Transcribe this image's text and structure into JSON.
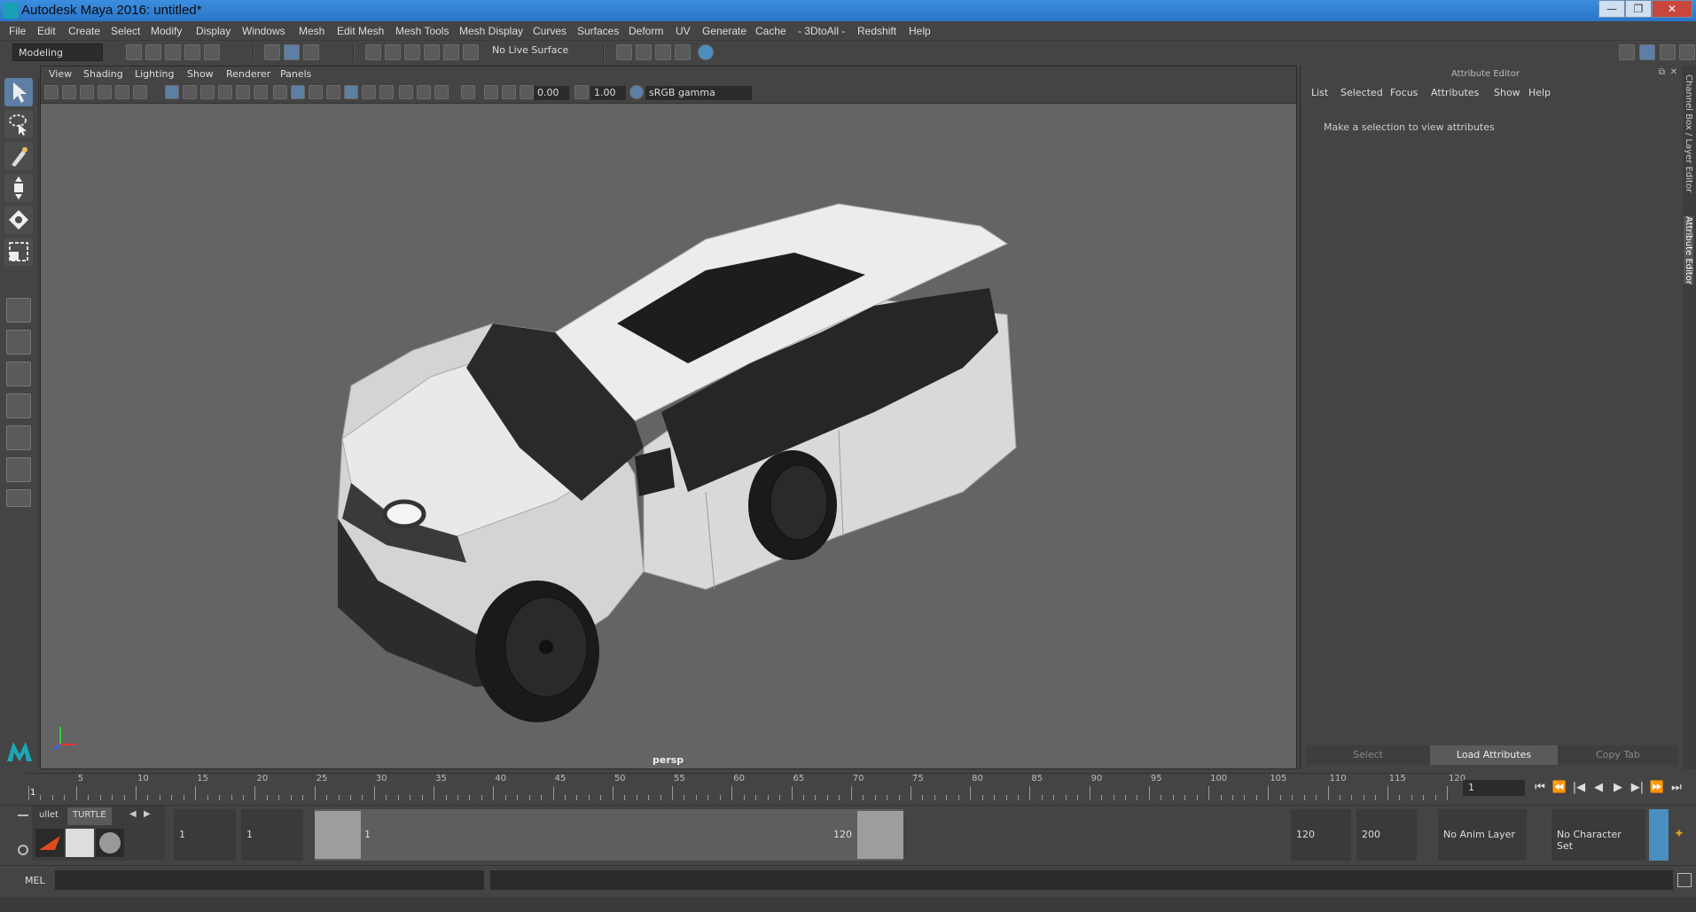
{
  "window": {
    "title": "Autodesk Maya 2016: untitled*",
    "buttons": [
      "—",
      "❐",
      "✕"
    ]
  },
  "menubar": [
    "File",
    "Edit",
    "Create",
    "Select",
    "Modify",
    "Display",
    "Windows",
    "Mesh",
    "Edit Mesh",
    "Mesh Tools",
    "Mesh Display",
    "Curves",
    "Surfaces",
    "Deform",
    "UV",
    "Generate",
    "Cache",
    "- 3DtoAll -",
    "Redshift",
    "Help"
  ],
  "statusline": {
    "mode": "Modeling",
    "live_surface": "No Live Surface"
  },
  "viewport": {
    "menu": [
      "View",
      "Shading",
      "Lighting",
      "Show",
      "Renderer",
      "Panels"
    ],
    "exposure": "0.00",
    "gamma": "1.00",
    "color_space": "sRGB gamma",
    "camera_label": "persp"
  },
  "attribute_editor": {
    "title": "Attribute Editor",
    "menu": [
      "List",
      "Selected",
      "Focus",
      "Attributes",
      "Show",
      "Help"
    ],
    "message": "Make a selection to view attributes",
    "buttons": [
      "Select",
      "Load Attributes",
      "Copy Tab"
    ],
    "side_tabs": [
      "Channel Box / Layer Editor",
      "Attribute Editor"
    ]
  },
  "timeline": {
    "tick_labels": [
      "1",
      "5",
      "10",
      "15",
      "20",
      "25",
      "30",
      "35",
      "40",
      "45",
      "50",
      "55",
      "60",
      "65",
      "70",
      "75",
      "80",
      "85",
      "90",
      "95",
      "100",
      "105",
      "110",
      "115",
      "120"
    ],
    "current_frame": "1",
    "playback_icons": [
      "⏮",
      "⏪",
      "|◀",
      "◀",
      "▶",
      "▶|",
      "⏩",
      "⏭"
    ]
  },
  "range": {
    "shelf_tabs": [
      "ullet",
      "TURTLE"
    ],
    "start_frame": "1",
    "playback_start": "1",
    "slider_start": "1",
    "slider_end": "120",
    "playback_end": "120",
    "end_frame": "200",
    "anim_layer": "No Anim Layer",
    "character_set": "No Character Set"
  },
  "cmdline": {
    "label": "MEL"
  },
  "colors": {
    "accent": "#5d7fa6",
    "title_bar": "#2a74c8",
    "viewport_bg": "#646464"
  }
}
